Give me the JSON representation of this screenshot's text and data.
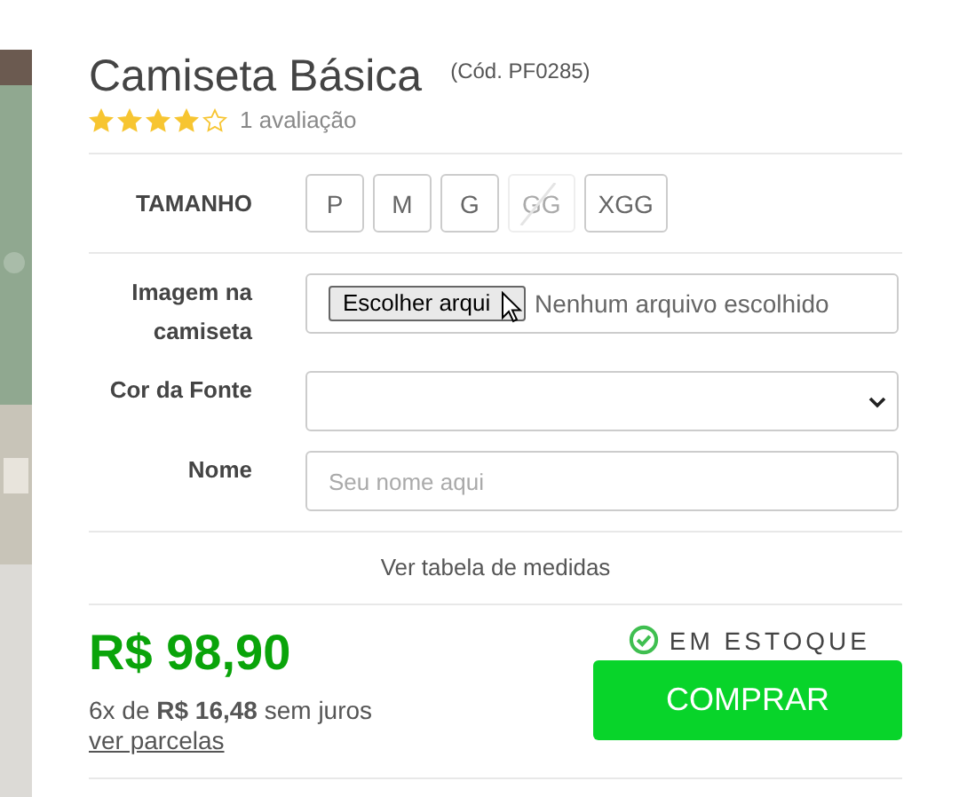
{
  "product": {
    "kind": "picture",
    "title": "Camiseta Básica",
    "code": "(Cód. PF0285)",
    "stars": 4,
    "reviews": "1 avaliação"
  },
  "size": {
    "label": "TAMANHO",
    "options": [
      {
        "label": "P",
        "selected": false,
        "disabled": false
      },
      {
        "label": "M",
        "selected": false,
        "disabled": false
      },
      {
        "label": "G",
        "selected": false,
        "disabled": false
      },
      {
        "label": "GG",
        "selected": false,
        "disabled": true
      },
      {
        "label": "XGG",
        "selected": false,
        "disabled": false
      }
    ]
  },
  "fields": [
    {
      "kind": "file",
      "label": "Imagem na camiseta",
      "button": "Escolher arqui",
      "status": "Nenhum arquivo escolhido"
    },
    {
      "kind": "select",
      "label": "Cor da Fonte"
    },
    {
      "kind": "text",
      "label": "Nome",
      "placeholder": "Seu nome aqui"
    }
  ],
  "size_chart_link": "Ver tabela de medidas",
  "price": "R$ 98,90",
  "installments": "6x de **R$ 16,48** sem juros",
  "installments_link": "ver parcelas",
  "stock": {
    "in_stock": true,
    "label": "EM ESTOQUE"
  },
  "buy_button": "COMPRAR"
}
